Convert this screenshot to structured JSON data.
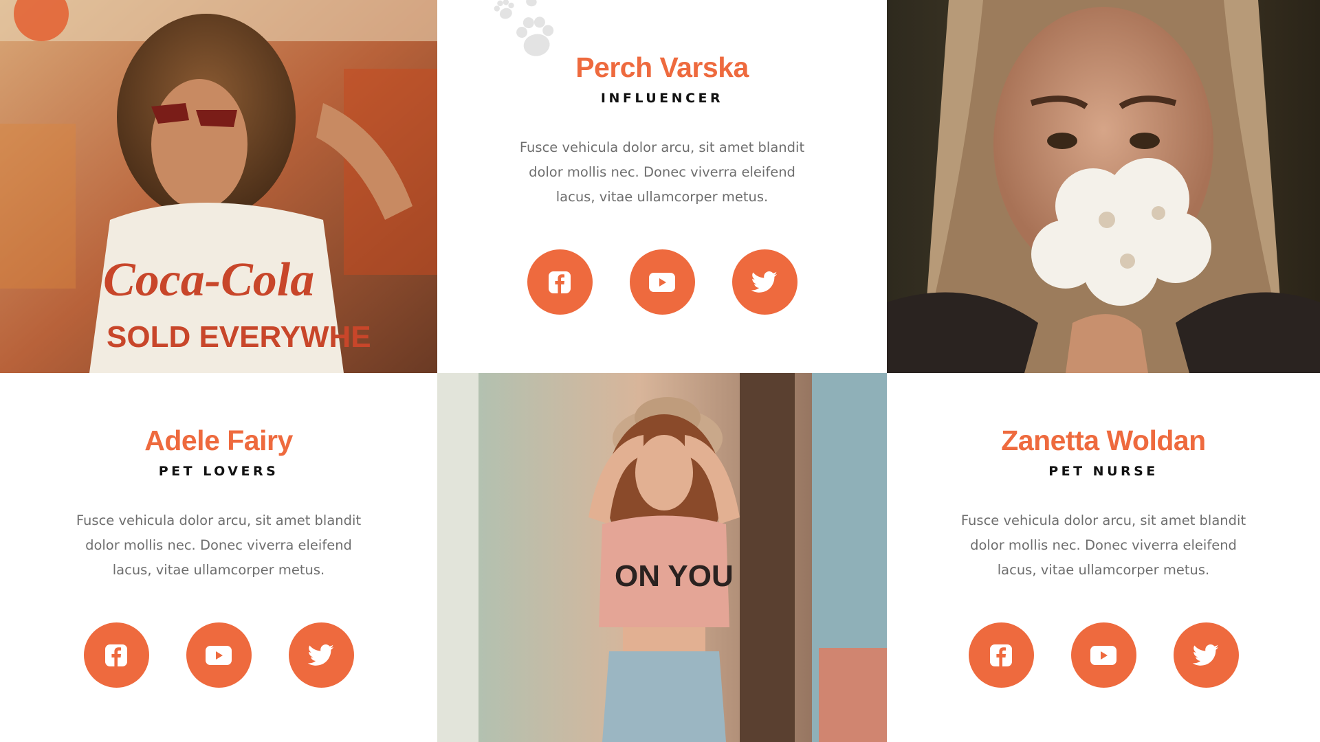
{
  "colors": {
    "accent": "#ee6a3e",
    "role_text": "#111111",
    "body_text": "#6e6e6e",
    "background": "#ffffff"
  },
  "team": [
    {
      "name": "Perch Varska",
      "role": "INFLUENCER",
      "description": "Fusce vehicula dolor arcu, sit amet blandit dolor mollis nec. Donec viverra eleifend lacus, vitae ullamcorper metus.",
      "socials": [
        "facebook-icon",
        "youtube-icon",
        "twitter-icon"
      ]
    },
    {
      "name": "Adele Fairy",
      "role": "PET LOVERS",
      "description": "Fusce vehicula dolor arcu, sit amet blandit dolor mollis nec. Donec viverra eleifend lacus, vitae ullamcorper metus.",
      "socials": [
        "facebook-icon",
        "youtube-icon",
        "twitter-icon"
      ]
    },
    {
      "name": "Zanetta Woldan",
      "role": "PET NURSE",
      "description": "Fusce vehicula dolor arcu, sit amet blandit dolor mollis nec. Donec viverra eleifend lacus, vitae ullamcorper metus.",
      "socials": [
        "facebook-icon",
        "youtube-icon",
        "twitter-icon"
      ]
    }
  ],
  "photos": [
    {
      "subject": "woman with curly hair and red sunglasses in t-shirt"
    },
    {
      "subject": "woman holding white flowers over her face"
    },
    {
      "subject": "woman in wide hat and crop top leaning on door"
    }
  ]
}
